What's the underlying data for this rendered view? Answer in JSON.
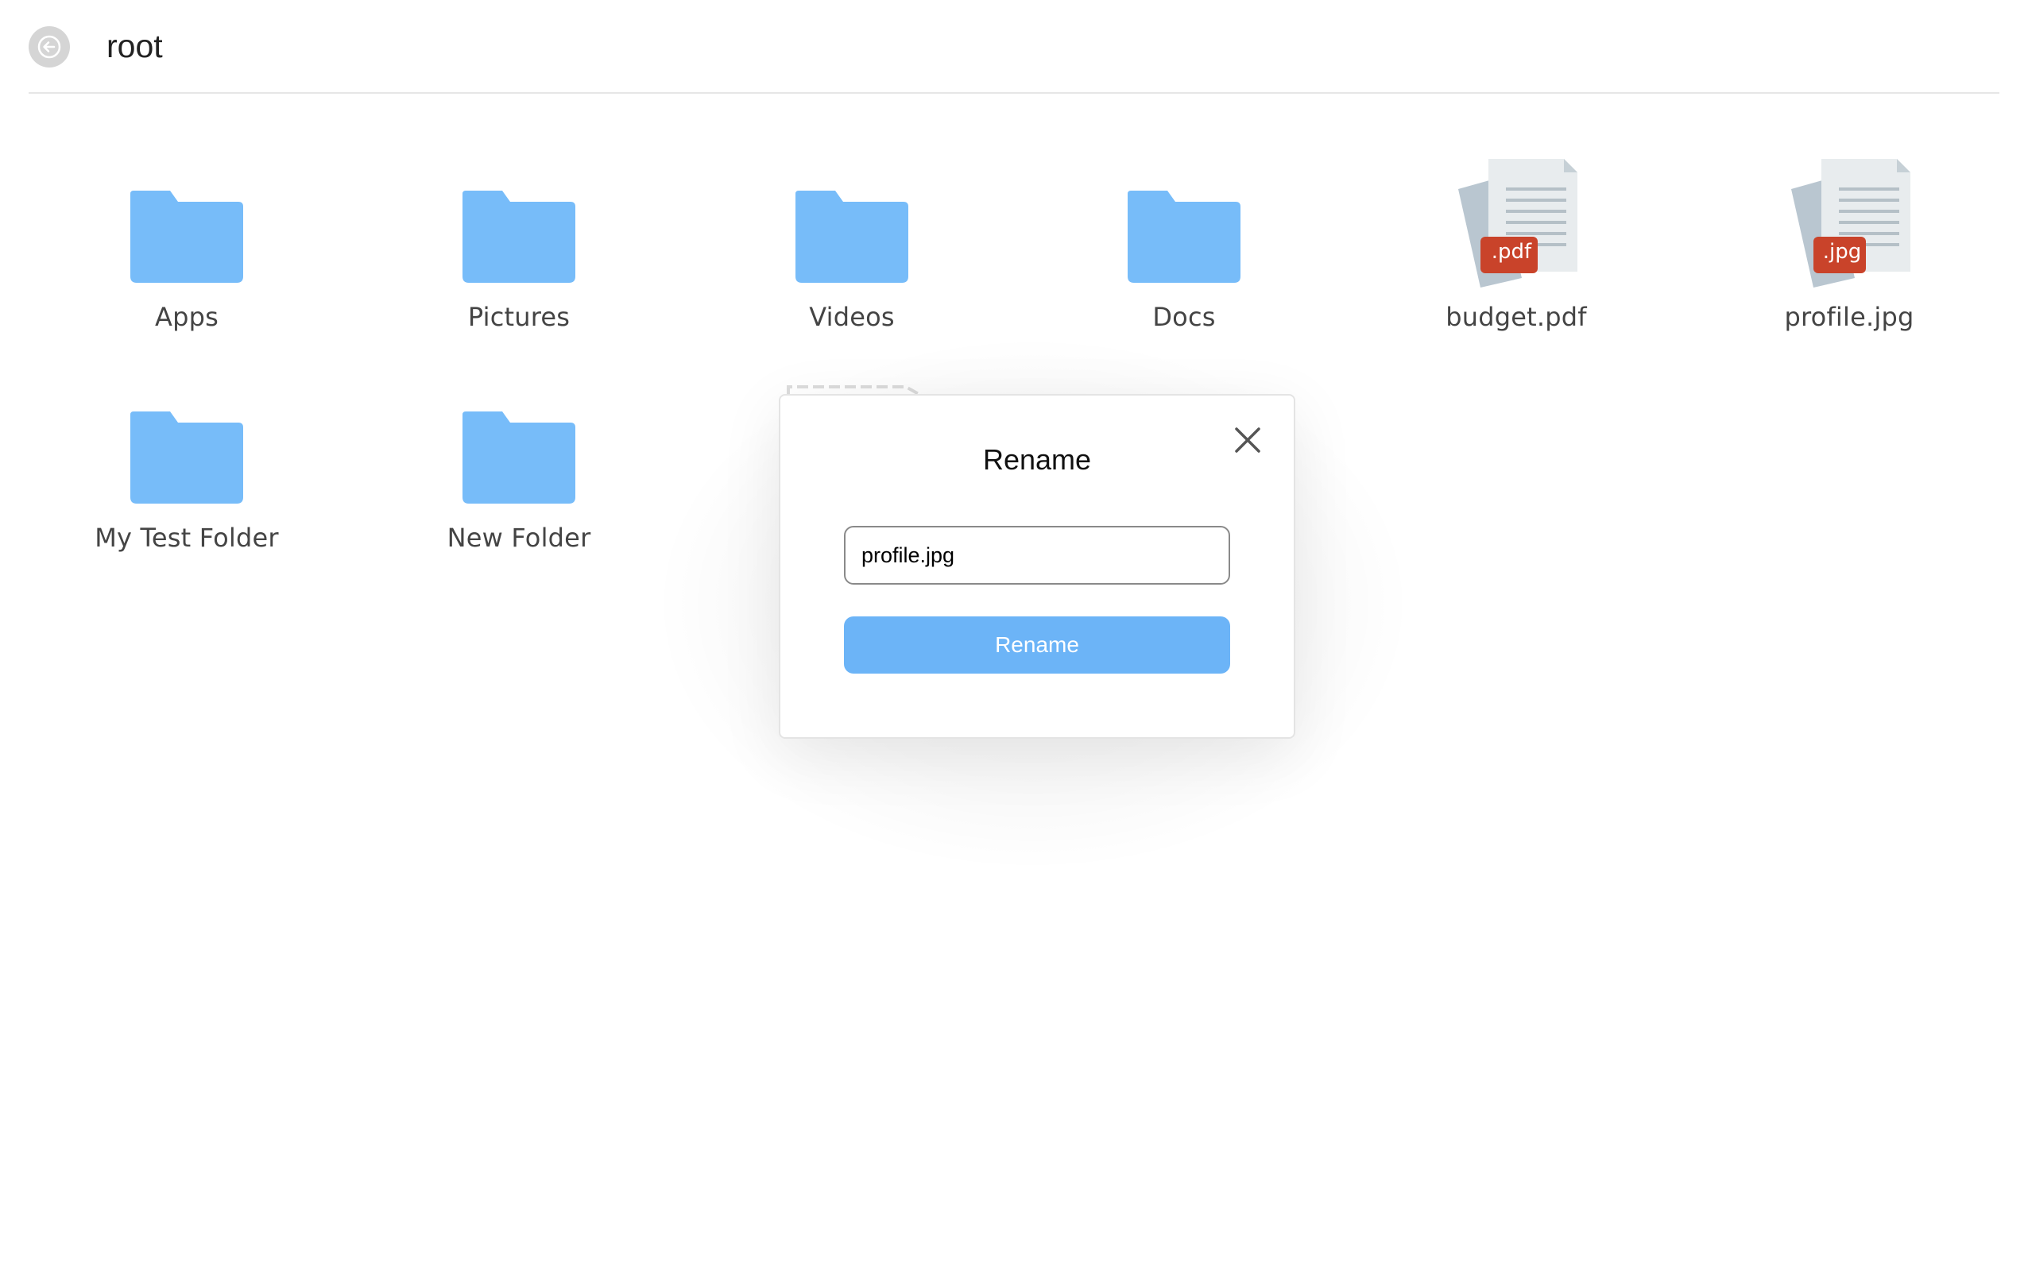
{
  "header": {
    "title": "root",
    "back_icon": "arrow-left-icon"
  },
  "items": [
    {
      "label": "Apps",
      "type": "folder"
    },
    {
      "label": "Pictures",
      "type": "folder"
    },
    {
      "label": "Videos",
      "type": "folder"
    },
    {
      "label": "Docs",
      "type": "folder"
    },
    {
      "label": "budget.pdf",
      "type": "file",
      "badge": ".pdf"
    },
    {
      "label": "profile.jpg",
      "type": "file",
      "badge": ".jpg"
    },
    {
      "label": "My Test Folder",
      "type": "folder"
    },
    {
      "label": "New Folder",
      "type": "folder"
    }
  ],
  "modal": {
    "title": "Rename",
    "input_value": "profile.jpg",
    "button_label": "Rename",
    "close_icon": "close-icon"
  },
  "colors": {
    "folder": "#77bcf9",
    "badge": "#c9432a",
    "button": "#6cb4f7"
  }
}
